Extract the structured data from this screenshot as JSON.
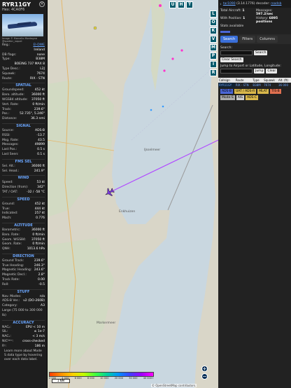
{
  "left": {
    "callsign": "RYR11GY",
    "hex_label": "Hex: 4CA0F6",
    "photo_credit": "Image © Marcello Montagna @spotter_napoli",
    "rows1": [
      {
        "k": "Reg.:",
        "v": "EI-DWE",
        "link": true
      },
      {
        "k": "",
        "v": "Ireland"
      },
      {
        "k": "DB flags:",
        "v": "none"
      },
      {
        "k": "Type:",
        "v": "B38M"
      },
      {
        "k": "",
        "v": "BOEING 737 MAX 8"
      },
      {
        "k": "Type Desc.:",
        "v": "L2J"
      },
      {
        "k": "Squawk:",
        "v": "7674"
      },
      {
        "k": "Route:",
        "v": "RIX - STN"
      }
    ],
    "sec_spatial": "SPATIAL",
    "rows_spatial": [
      {
        "k": "Groundspeed:",
        "v": "452 kt"
      },
      {
        "k": "Baro. altitude:",
        "v": "36000 ft"
      },
      {
        "k": "WGS84 altitude:",
        "v": "37050 ft"
      },
      {
        "k": "Vert. Rate:",
        "v": "0 ft/min"
      },
      {
        "k": "Track:",
        "v": "239.6°"
      },
      {
        "k": "Pos.:",
        "v": "52.735°, 5.246°"
      },
      {
        "k": "Distance:",
        "v": "36.3 nmi"
      }
    ],
    "sec_signal": "SIGNAL",
    "rows_signal": [
      {
        "k": "Source:",
        "v": "ADS-B"
      },
      {
        "k": "RSSI:",
        "v": "-13.7"
      },
      {
        "k": "Msg. Rate:",
        "v": "43.5"
      },
      {
        "k": "Messages:",
        "v": "49899"
      },
      {
        "k": "Last Pos.:",
        "v": "0.5 s"
      },
      {
        "k": "Last Seen:",
        "v": "0.1 s"
      }
    ],
    "sec_fms": "FMS SEL",
    "rows_fms": [
      {
        "k": "Sel. Alt.:",
        "v": "36000 ft"
      },
      {
        "k": "Sel. Head.:",
        "v": "241.9°"
      }
    ],
    "sec_wind": "WIND",
    "rows_wind": [
      {
        "k": "Speed:",
        "v": "53 kt"
      },
      {
        "k": "Direction (from):",
        "v": "342°"
      },
      {
        "k": "TAT / OAT:",
        "v": "-32 / -58 °C"
      }
    ],
    "sec_speed": "SPEED",
    "rows_speed": [
      {
        "k": "Ground:",
        "v": "452 kt"
      },
      {
        "k": "True:",
        "v": "444 kt"
      },
      {
        "k": "Indicated:",
        "v": "257 kt"
      },
      {
        "k": "Mach:",
        "v": "0.776"
      }
    ],
    "sec_altitude": "ALTITUDE",
    "rows_altitude": [
      {
        "k": "Barometric:",
        "v": "36000 ft"
      },
      {
        "k": "Baro. Rate:",
        "v": "0 ft/min"
      },
      {
        "k": "Geom. WGS84:",
        "v": "37050 ft"
      },
      {
        "k": "Geom. Rate:",
        "v": "0 ft/min"
      },
      {
        "k": "QNH:",
        "v": "1013.6 hPa"
      }
    ],
    "sec_direction": "DIRECTION",
    "rows_direction": [
      {
        "k": "Ground Track:",
        "v": "239.6°"
      },
      {
        "k": "True Heading:",
        "v": "246.3°"
      },
      {
        "k": "Magnetic Heading:",
        "v": "243.6°"
      },
      {
        "k": "Magnetic Decl.:",
        "v": "2.8°"
      },
      {
        "k": "Track Rate:",
        "v": "0.00"
      },
      {
        "k": "Roll:",
        "v": "-0.5"
      }
    ],
    "sec_stuff": "STUFF",
    "rows_stuff": [
      {
        "k": "Nav. Modes:",
        "v": "n/a"
      },
      {
        "k": "ADS-B Ver.:",
        "v": "v2 (DO-260B)"
      },
      {
        "k": "Category:",
        "v": "A3"
      },
      {
        "k": "Large (75 000 to 300 000 lb)",
        "v": ""
      }
    ],
    "sec_accuracy": "ACCURACY",
    "rows_accuracy": [
      {
        "k": "NACₚ:",
        "v": "EPU < 10 m"
      },
      {
        "k": "SIL:",
        "v": "≤ 1e-7"
      },
      {
        "k": "NACᵥ:",
        "v": "< 3 m/s"
      },
      {
        "k": "NICᵇᵃʳᵒ:",
        "v": "cross-checked"
      },
      {
        "k": "Rᶜ:",
        "v": "186 m"
      }
    ],
    "note": "Learn more about Mode S data type by hovering over each data label."
  },
  "map": {
    "top_buttons": [
      "U",
      "H",
      "T"
    ],
    "side_buttons": [
      "L",
      "O",
      "K",
      "V",
      "M",
      "P",
      "I",
      "R"
    ],
    "zoom_in": "+",
    "zoom_out": "−",
    "scale": "1 NM",
    "colorbar_labels": [
      "2 000",
      "4 000",
      "6 000",
      "8 000",
      "10 000",
      "20 000",
      "30 000",
      "40 000+"
    ],
    "places": {
      "ijsselmeer": "IJsselmeer",
      "markermeer": "Markermeer",
      "enkhuizen": "Enkhuizen"
    },
    "attribution": "© OpenStreetMap contributors.",
    "colors": {
      "land": "#d9d6c8",
      "water": "#c9d7e0",
      "track": "#b14cff",
      "aircraft": "#7a3bd9"
    }
  },
  "right": {
    "version_link": "tar1090",
    "version_rest": "(3.14.1776) decoder:",
    "version_link2": "readsb",
    "stats": [
      {
        "label": "Total Aircraft:",
        "value": "1"
      },
      {
        "label": "Messages:",
        "value": "597.2/sec"
      },
      {
        "label": "With Position:",
        "value": "1"
      },
      {
        "label": "History:",
        "value": "6895 positions"
      },
      {
        "label": "Stats available",
        "value": ""
      }
    ],
    "tabs": [
      "Search",
      "Filters",
      "Columns"
    ],
    "search_label": "Search:",
    "search_btn": "Search",
    "clear_btn": "Clear Search",
    "jump_label": "Jump to Airport or Latitude, Longitude:",
    "jump_btn": "Jump",
    "jump_clear": "Clear",
    "table_headers": [
      "Callsign",
      "Route",
      "Type",
      "Squawk",
      "Alt. (ft)"
    ],
    "table_rows": [
      {
        "callsign": "RYR11GY",
        "route": "RIX - STN",
        "type": "B38M",
        "squawk": "7674",
        "alt": "36 000"
      }
    ],
    "legend": [
      {
        "label": "ADS-B",
        "color": "#4b66d6"
      },
      {
        "label": "UAT / ADS-R",
        "color": "#d9b84b"
      },
      {
        "label": "MLAT",
        "color": "#d9b84b"
      },
      {
        "label": "TIS-B",
        "color": "#e07050"
      },
      {
        "label": "Mode-S",
        "color": "#aaaaaa"
      },
      {
        "label": "AIS",
        "color": "#cccccc"
      },
      {
        "label": "ADS-C",
        "color": "#d9b84b"
      }
    ]
  }
}
